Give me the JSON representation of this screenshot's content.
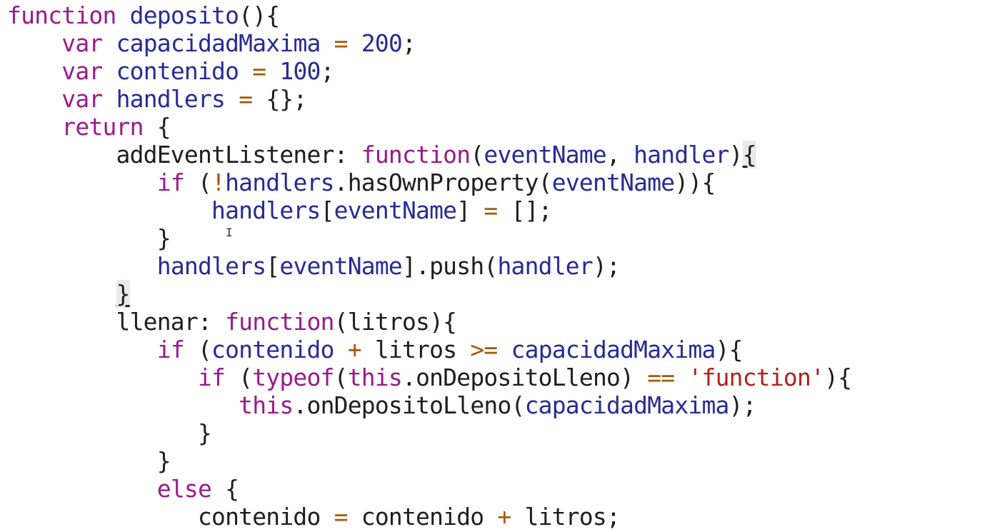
{
  "editor": {
    "text_cursor_glyph": "I",
    "colors": {
      "background": "#ffffff",
      "keyword": "#9b1a8a",
      "identifier": "#262b96",
      "operator": "#a45a06",
      "number": "#262b96",
      "string": "#b3201c",
      "plain": "#1e1e1e",
      "bracket_match_bg": "#e9e9e9"
    },
    "lines": [
      [
        [
          "kw",
          "function"
        ],
        [
          "p",
          " "
        ],
        [
          "v",
          "deposito"
        ],
        [
          "p",
          "(){"
        ]
      ],
      [
        [
          "p",
          "    "
        ],
        [
          "kw",
          "var"
        ],
        [
          "p",
          " "
        ],
        [
          "v",
          "capacidadMaxima"
        ],
        [
          "p",
          " "
        ],
        [
          "op",
          "="
        ],
        [
          "p",
          " "
        ],
        [
          "num",
          "200"
        ],
        [
          "p",
          ";"
        ]
      ],
      [
        [
          "p",
          "    "
        ],
        [
          "kw",
          "var"
        ],
        [
          "p",
          " "
        ],
        [
          "v",
          "contenido"
        ],
        [
          "p",
          " "
        ],
        [
          "op",
          "="
        ],
        [
          "p",
          " "
        ],
        [
          "num",
          "100"
        ],
        [
          "p",
          ";"
        ]
      ],
      [
        [
          "p",
          "    "
        ],
        [
          "kw",
          "var"
        ],
        [
          "p",
          " "
        ],
        [
          "v",
          "handlers"
        ],
        [
          "p",
          " "
        ],
        [
          "op",
          "="
        ],
        [
          "p",
          " {};"
        ]
      ],
      [
        [
          "p",
          "    "
        ],
        [
          "kw",
          "return"
        ],
        [
          "p",
          " {"
        ]
      ],
      [
        [
          "p",
          "        addEventListener: "
        ],
        [
          "kw",
          "function"
        ],
        [
          "p",
          "("
        ],
        [
          "v",
          "eventName"
        ],
        [
          "p",
          ", "
        ],
        [
          "v",
          "handler"
        ],
        [
          "p",
          ")"
        ],
        [
          "bm",
          "{"
        ]
      ],
      [
        [
          "p",
          "           "
        ],
        [
          "kw",
          "if"
        ],
        [
          "p",
          " ("
        ],
        [
          "op",
          "!"
        ],
        [
          "v",
          "handlers"
        ],
        [
          "p",
          ".hasOwnProperty("
        ],
        [
          "v",
          "eventName"
        ],
        [
          "p",
          "))"
        ],
        [
          "p",
          "{"
        ]
      ],
      [
        [
          "p",
          "               "
        ],
        [
          "v",
          "handlers"
        ],
        [
          "p",
          "["
        ],
        [
          "v",
          "eventName"
        ],
        [
          "p",
          "] "
        ],
        [
          "op",
          "="
        ],
        [
          "p",
          " [];"
        ]
      ],
      [
        [
          "p",
          "           }"
        ]
      ],
      [
        [
          "p",
          "           "
        ],
        [
          "v",
          "handlers"
        ],
        [
          "p",
          "["
        ],
        [
          "v",
          "eventName"
        ],
        [
          "p",
          "].push("
        ],
        [
          "v",
          "handler"
        ],
        [
          "p",
          ");"
        ]
      ],
      [
        [
          "p",
          "        "
        ],
        [
          "bm",
          "}"
        ]
      ],
      [
        [
          "p",
          "        llenar: "
        ],
        [
          "kw",
          "function"
        ],
        [
          "p",
          "(litros){"
        ]
      ],
      [
        [
          "p",
          "           "
        ],
        [
          "kw",
          "if"
        ],
        [
          "p",
          " ("
        ],
        [
          "v",
          "contenido"
        ],
        [
          "p",
          " "
        ],
        [
          "op",
          "+"
        ],
        [
          "p",
          " litros "
        ],
        [
          "op",
          ">="
        ],
        [
          "p",
          " "
        ],
        [
          "v",
          "capacidadMaxima"
        ],
        [
          "p",
          "){"
        ]
      ],
      [
        [
          "p",
          "              "
        ],
        [
          "kw",
          "if"
        ],
        [
          "p",
          " ("
        ],
        [
          "kw",
          "typeof"
        ],
        [
          "p",
          "("
        ],
        [
          "kw",
          "this"
        ],
        [
          "p",
          ".onDepositoLleno) "
        ],
        [
          "op",
          "=="
        ],
        [
          "p",
          " "
        ],
        [
          "str",
          "'function'"
        ],
        [
          "p",
          "){"
        ]
      ],
      [
        [
          "p",
          "                 "
        ],
        [
          "kw",
          "this"
        ],
        [
          "p",
          ".onDepositoLleno("
        ],
        [
          "v",
          "capacidadMaxima"
        ],
        [
          "p",
          ");"
        ]
      ],
      [
        [
          "p",
          "              }"
        ]
      ],
      [
        [
          "p",
          "           }"
        ]
      ],
      [
        [
          "p",
          "           "
        ],
        [
          "kw",
          "else"
        ],
        [
          "p",
          " {"
        ]
      ],
      [
        [
          "p",
          "              contenido "
        ],
        [
          "op",
          "="
        ],
        [
          "p",
          " contenido "
        ],
        [
          "op",
          "+"
        ],
        [
          "p",
          " litros;"
        ]
      ]
    ]
  }
}
